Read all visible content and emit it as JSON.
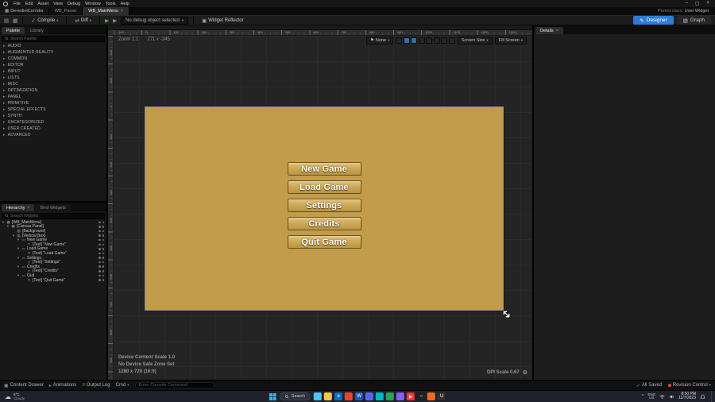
{
  "colors": {
    "accent": "#2e7cd6",
    "menu_button_face": "#d0a954",
    "menu_button_border": "#6b5214"
  },
  "icons": {
    "collapsed_arrow": "▸",
    "dropdown_arrow": "▾",
    "close": "×",
    "minimize": "–",
    "maximize": "▢",
    "check": "✓",
    "play": "▶",
    "gear": "⚙",
    "flag": "⚑",
    "save": "▤",
    "browse": "▦",
    "diff": "⇄",
    "reflector": "▣",
    "designer": "✎",
    "graph": "▤",
    "content_drawer": "▣",
    "animations": "▸",
    "output_log": "≡",
    "cloud": "☁",
    "chevron_up": "^",
    "project": "▦",
    "saved_check": "✓"
  },
  "titlebar": {
    "menus": [
      "File",
      "Edit",
      "Asset",
      "View",
      "Debug",
      "Window",
      "Tools",
      "Help"
    ]
  },
  "tabbar": {
    "project_tab": "DevedintCorridor",
    "tabs": [
      {
        "label": "WB_Pause"
      },
      {
        "label": "WB_MainMenu"
      }
    ],
    "parent_class_label": "Parent class:",
    "parent_class_value": "User Widget"
  },
  "toolbar": {
    "compile_label": "Compile",
    "diff_label": "Diff",
    "debug_dropdown_label": "No debug object selected",
    "widget_reflector_label": "Widget Reflector",
    "designer_label": "Designer",
    "graph_label": "Graph"
  },
  "palette": {
    "tabs": {
      "palette": "Palette",
      "library": "Library"
    },
    "search_placeholder": "Search Palette",
    "categories": [
      "AUDIO",
      "AUGMENTED REALITY",
      "COMMON",
      "EDITOR",
      "INPUT",
      "LISTS",
      "MISC",
      "OPTIMIZATION",
      "PANEL",
      "PRIMITIVE",
      "SPECIAL EFFECTS",
      "SYNTH",
      "UNCATEGORIZED",
      "USER CREATED",
      "ADVANCED"
    ]
  },
  "hierarchy": {
    "tabs": {
      "hierarchy": "Hierarchy",
      "bind_widgets": "Bind Widgets"
    },
    "search_placeholder": "Search Widgets",
    "rows": [
      {
        "label": "[WB_MainMenu]",
        "chip": "▦",
        "arrow": "▾",
        "indent": 2
      },
      {
        "label": "[Canvas Panel]",
        "chip": "▦",
        "arrow": "▾",
        "indent": 8
      },
      {
        "label": "[Background]",
        "chip": "▨",
        "arrow": "",
        "indent": 15
      },
      {
        "label": "[Vertical Box]",
        "chip": "▤",
        "arrow": "▾",
        "indent": 15
      },
      {
        "label": "New Game",
        "chip": "▭",
        "arrow": "▾",
        "indent": 21
      },
      {
        "label": "[Text] \"New Game\"",
        "chip": "T",
        "arrow": "",
        "indent": 28
      },
      {
        "label": "Load Game",
        "chip": "▭",
        "arrow": "▾",
        "indent": 21
      },
      {
        "label": "[Text] \"Load Game\"",
        "chip": "T",
        "arrow": "",
        "indent": 28
      },
      {
        "label": "Settings",
        "chip": "▭",
        "arrow": "▾",
        "indent": 21
      },
      {
        "label": "[Text] \"Settings\"",
        "chip": "T",
        "arrow": "",
        "indent": 28
      },
      {
        "label": "Credits",
        "chip": "▭",
        "arrow": "▾",
        "indent": 21
      },
      {
        "label": "[Text] \"Credits\"",
        "chip": "T",
        "arrow": "",
        "indent": 28
      },
      {
        "label": "Quit",
        "chip": "▭",
        "arrow": "▾",
        "indent": 21
      },
      {
        "label": "[Text] \"Quit Game\"",
        "chip": "T",
        "arrow": "",
        "indent": 28
      }
    ]
  },
  "canvas": {
    "zoom_label": "Zoom 1:1",
    "cursor_pos": "271 x -245",
    "none_dropdown": "None",
    "screen_size_dropdown": "Screen Size",
    "fill_screen_dropdown": "Fill Screen",
    "ruler_top": [
      "-100",
      "0",
      "100",
      "200",
      "300",
      "400",
      "500",
      "600",
      "700",
      "800",
      "900",
      "1000",
      "1100",
      "1200",
      "1300"
    ],
    "ruler_left": [
      "-200",
      "-100",
      "0",
      "100",
      "200",
      "300",
      "400",
      "500",
      "600",
      "700",
      "800",
      "900"
    ],
    "view_toggles": [
      {
        "name": "preview-background-icon",
        "bg": "#262626"
      },
      {
        "name": "phone-portrait-icon",
        "bg": "#2d6fb0"
      },
      {
        "name": "phone-landscape-icon",
        "bg": "#2d6fb0"
      },
      {
        "name": "monitor-icon",
        "bg": "#262626"
      },
      {
        "name": "tablet-icon",
        "bg": "#262626"
      },
      {
        "name": "tv-icon",
        "bg": "#262626"
      },
      {
        "name": "safe-zone-icon",
        "bg": "#262626"
      },
      {
        "name": "grid-snap-icon",
        "bg": "#262626"
      }
    ],
    "widget": {
      "background_color": "#c29c4b",
      "buttons": [
        {
          "label": "New Game"
        },
        {
          "label": "Load Game"
        },
        {
          "label": "Settings"
        },
        {
          "label": "Credits"
        },
        {
          "label": "Quit Game"
        }
      ]
    },
    "info": {
      "line1": "Device Content Scale 1.0",
      "line2": "No Device Safe Zone Set",
      "line3": "1280 x 720 (16:9)",
      "dpi": "DPI Scale 0.67"
    }
  },
  "details": {
    "tab_label": "Details"
  },
  "statusbar": {
    "content_drawer": "Content Drawer",
    "animations": "Animations",
    "output_log": "Output Log",
    "cmd": "Cmd",
    "console_placeholder": "Enter Console Command",
    "all_saved": "All Saved",
    "revision_control": "Revision Control"
  },
  "taskbar": {
    "weather_temp": "6°C",
    "weather_desc": "Cloudy",
    "search_placeholder": "Search",
    "apps": [
      {
        "name": "widgets-icon",
        "color": "#4cc2ff",
        "glyph": ""
      },
      {
        "name": "file-explorer-icon",
        "color": "#f6c64a",
        "glyph": ""
      },
      {
        "name": "edge-icon",
        "color": "#0f6cbd",
        "glyph": "e"
      },
      {
        "name": "chrome-icon",
        "color": "#e94235",
        "glyph": ""
      },
      {
        "name": "word-icon",
        "color": "#185abd",
        "glyph": "W"
      },
      {
        "name": "discord-icon",
        "color": "#5865f2",
        "glyph": ""
      },
      {
        "name": "steam-icon",
        "color": "#00b7c3",
        "glyph": ""
      },
      {
        "name": "spotify-icon",
        "color": "#23a55a",
        "glyph": ""
      },
      {
        "name": "photoshop-icon",
        "color": "#8b5cf6",
        "glyph": ""
      },
      {
        "name": "youtube-icon",
        "color": "#ff3333",
        "glyph": "▶"
      },
      {
        "name": "obs-icon",
        "color": "#1f1f1f",
        "glyph": "○"
      },
      {
        "name": "blender-icon",
        "color": "#f06a1d",
        "glyph": ""
      },
      {
        "name": "unreal-icon",
        "color": "#303030",
        "glyph": "U"
      }
    ],
    "tray": {
      "lang_line1": "ENG",
      "lang_line2": "US",
      "time": "8:50 PM",
      "date": "11/7/2023"
    }
  }
}
